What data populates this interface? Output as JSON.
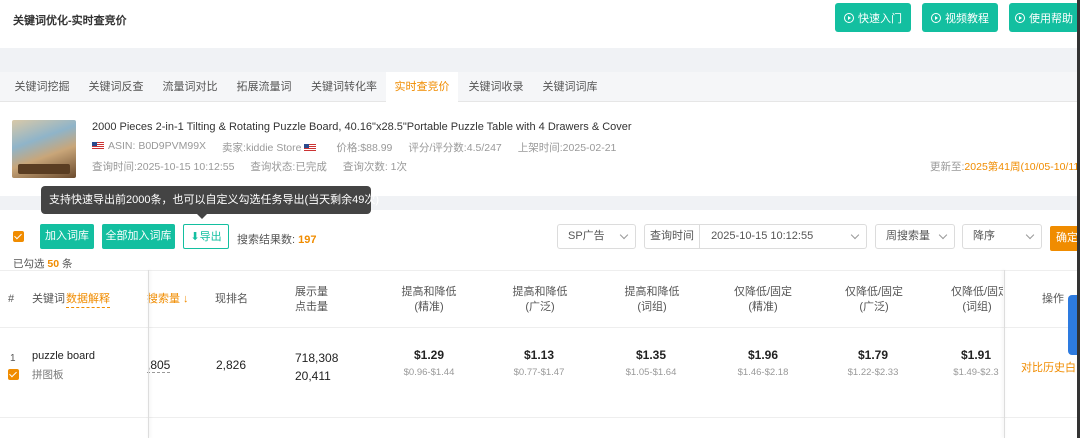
{
  "header": {
    "title": "关键词优化-实时查竞价",
    "buttons": [
      {
        "label": "快速入门",
        "icon": "play-circle-icon"
      },
      {
        "label": "视频教程",
        "icon": "play-circle-icon"
      },
      {
        "label": "使用帮助",
        "icon": "help-circle-icon"
      }
    ]
  },
  "tabs": [
    "关键词挖掘",
    "关键词反查",
    "流量词对比",
    "拓展流量词",
    "关键词转化率",
    "实时查竞价",
    "关键词收录",
    "关键词词库"
  ],
  "active_tab": "实时查竞价",
  "product": {
    "title": "2000 Pieces 2-in-1 Tilting & Rotating Puzzle Board, 40.16\"x28.5\"Portable Puzzle Table with 4 Drawers & Cover",
    "asin": "ASIN: B0D9PVM99X",
    "seller": "卖家:kiddie Store",
    "price": "价格:$88.99",
    "rating": "评分/评分数:4.5/247",
    "listed": "上架时间:2025-02-21",
    "query_time": "查询时间:2025-10-15 10:12:55",
    "query_status": "查询状态:已完成",
    "query_count": "查询次数: 1次",
    "updated_label": "更新至:",
    "updated_value": "2025第41周(10/05-10/11"
  },
  "tooltip": "支持快速导出前2000条，也可以自定义勾选任务导出(当天剩余49次)",
  "toolbar": {
    "add_lib": "加入词库",
    "add_all_lib": "全部加入词库",
    "export": "导出",
    "result_label": "搜索结果数:",
    "result_count": "197",
    "selected_prefix": "已勾选",
    "selected_count": "50",
    "selected_suffix": "条",
    "ad_type": "SP广告",
    "query_time_label": "查询时间",
    "query_time_value": "2025-10-15 10:12:55",
    "sort_field": "周搜索量",
    "sort_order": "降序",
    "confirm": "确定"
  },
  "table": {
    "headers": {
      "index": "#",
      "keyword": "关键词",
      "data_explain": "数据解释",
      "search_volume": "搜索量 ↓",
      "rank": "现排名",
      "impressions": "展示量",
      "clicks": "点击量",
      "raise_exact_1": "提高和降低",
      "raise_exact_2": "(精准)",
      "raise_broad_1": "提高和降低",
      "raise_broad_2": "(广泛)",
      "raise_phrase_1": "提高和降低",
      "raise_phrase_2": "(词组)",
      "down_exact_1": "仅降低/固定",
      "down_exact_2": "(精准)",
      "down_broad_1": "仅降低/固定",
      "down_broad_2": "(广泛)",
      "down_phrase_1": "仅降低/固定",
      "down_phrase_2": "(词组)",
      "action": "操作"
    },
    "rows": [
      {
        "index": "1",
        "keyword": "puzzle board",
        "keyword_cn": "拼图板",
        "search_volume": ",805",
        "rank": "2,826",
        "impressions": "718,308",
        "clicks": "20,411",
        "raise_exact": "$1.29",
        "raise_exact_range": "$0.96-$1.44",
        "raise_broad": "$1.13",
        "raise_broad_range": "$0.77-$1.47",
        "raise_phrase": "$1.35",
        "raise_phrase_range": "$1.05-$1.64",
        "down_exact": "$1.96",
        "down_exact_range": "$1.46-$2.18",
        "down_broad": "$1.79",
        "down_broad_range": "$1.22-$2.33",
        "down_phrase": "$1.91",
        "down_phrase_range": "$1.49-$2.3",
        "action": "对比历史白"
      }
    ]
  },
  "colors": {
    "accent": "#13bfa0",
    "orange": "#f08c00"
  }
}
